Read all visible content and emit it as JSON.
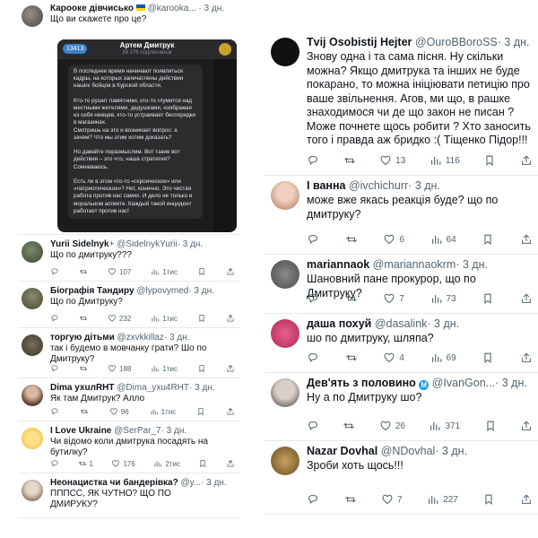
{
  "left": {
    "main_tweet": {
      "name": "Карооке дівчисько",
      "handle": "@karooka...",
      "time": "· 3 дн.",
      "text": "Що ви скажете про це?"
    },
    "telegram": {
      "back_count": "13413",
      "channel": "Артем Дмитрук",
      "subscribers": "39 276 подписчиков",
      "message": "В последнее время начинают появляться кадры, на которых запечатлены действия наших бойцов в Курской области.\n\nКто-то рушит памятники, кто-то глумится над местными жителями, дедушками, изображая из себя немцев, кто-то устраивает беспорядки в магазинах.\nСмотришь на это и возникает вопрос: а зачем? Что мы этим хотим доказать?\n\nНо давайте поразмыслим. Вот такие вот действия – это что, наша стратегия? Сомневаюсь.\n\nЕсть ли в этом что-то «героическое» или «патриотическое»? Нет, конечно. Это чистая работа против нас самих. И дело не только в моральном аспекте. Каждый такой инцидент работает против нас!"
    },
    "replies": [
      {
        "name": "Yurii Sidelnyk",
        "badge": "+",
        "handle": "@SidelnykYurii",
        "time": "· 3 дн.",
        "text": "Що по дмитруку???",
        "reply": "",
        "retweet": "",
        "like": "107",
        "views": "1тис"
      },
      {
        "name": "Біографія Тандиру",
        "handle": "@lypovymed",
        "time": "· 3 дн.",
        "text": "Що по Дмитруку?",
        "reply": "",
        "retweet": "",
        "like": "232",
        "views": "1тис"
      },
      {
        "name": "торгую дітьми",
        "handle": "@zxvkkillaz",
        "time": "· 3 дн.",
        "text": "так і будемо в мовчанку грати? Шо по Дмитруку?",
        "reply": "",
        "retweet": "",
        "like": "188",
        "views": "1тис"
      },
      {
        "name": "Dima ухuлRHT",
        "handle": "@Dima_yxu4RHT",
        "time": "· 3 дн.",
        "text": "Як там Дмитрук? Алло",
        "reply": "",
        "retweet": "",
        "like": "96",
        "views": "1тис"
      },
      {
        "name": "I Love Ukraine",
        "handle": "@SerPar_7",
        "time": "· 3 дн.",
        "text": "Чи відомо коли дмитрука посадять на бутилку?",
        "reply": "",
        "retweet": "1",
        "like": "176",
        "views": "2тис"
      },
      {
        "name": "Неонацистка чи бандерівка?",
        "handle": "@у...",
        "time": "· 3 дн.",
        "text": "ПППСС, ЯК ЧУТНО? ЩО ПО ДМИРУКУ?"
      }
    ]
  },
  "right": {
    "tweets": [
      {
        "name": "Tvij Osobistij Hejter",
        "handle": "@OuroBBoroSS",
        "time": "· 3 дн.",
        "text": "Знову одна і та сама пісня. Ну скільки можна? Якщо дмитрука та інших не буде покарано, то можна ініціювати петицію про ваше звільнення. Агов, ми що, в рашке знаходимося чи де що закон не писан ? Може почнете щось робити ? Хто заносить того і правда аж бридко :( Тіщенко Підор!!!",
        "like": "13",
        "views": "116"
      },
      {
        "name": "І ванна",
        "handle": "@ivchichurr",
        "time": "· 3 дн.",
        "text": "може вже якась реакція буде? що по дмитруку?",
        "like": "6",
        "views": "64"
      },
      {
        "name": "mariannaok",
        "handle": "@mariannaokrm",
        "time": "· 3 дн.",
        "text": "Шановний пане прокурор, що по Дмитруку?",
        "like": "7",
        "views": "73"
      },
      {
        "name": "даша похуй",
        "handle": "@dasalink",
        "time": "· 3 дн.",
        "text": "шо по дмитруку, шляпа?",
        "like": "4",
        "views": "69"
      },
      {
        "name": "Дев'ять з половино",
        "badge": "M",
        "handle": "@IvanGon...",
        "time": "· 3 дн.",
        "text": "Ну а по Дмитруку шо?",
        "like": "26",
        "views": "371"
      },
      {
        "name": "Nazar Dovhal",
        "handle": "@NDovhal",
        "time": "· 3 дн.",
        "text": "Зроби хоть щось!!!",
        "like": "7",
        "views": "227"
      }
    ]
  },
  "colors": {
    "text": "#0f1419",
    "muted": "#536471",
    "accent": "#1d9bf0",
    "divider": "#e7e9ea"
  }
}
